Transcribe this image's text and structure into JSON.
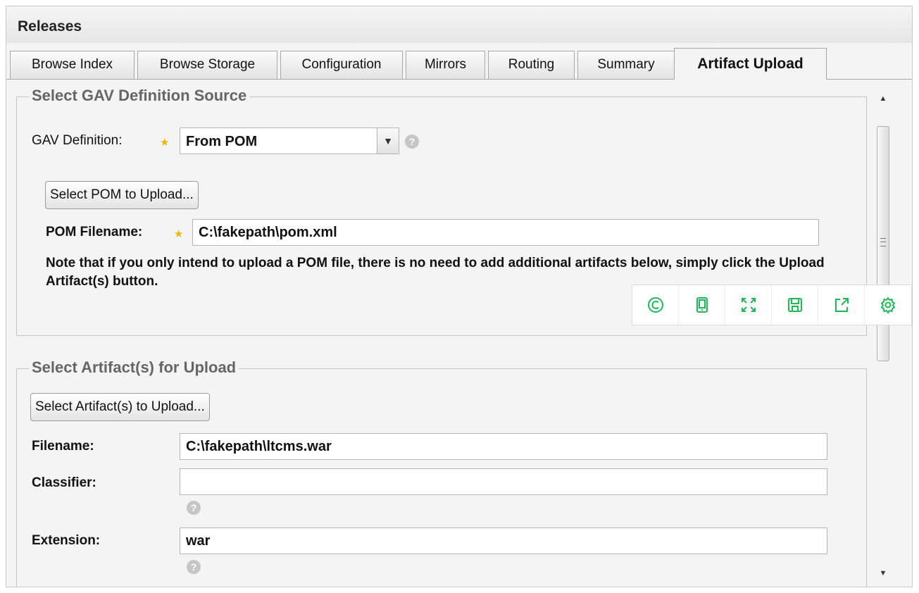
{
  "window": {
    "title": "Releases"
  },
  "tabs": [
    {
      "label": "Browse Index"
    },
    {
      "label": "Browse Storage"
    },
    {
      "label": "Configuration"
    },
    {
      "label": "Mirrors"
    },
    {
      "label": "Routing"
    },
    {
      "label": "Summary"
    },
    {
      "label": "Artifact Upload",
      "active": true
    }
  ],
  "gav_section": {
    "legend": "Select GAV Definition Source",
    "gav_label": "GAV Definition:",
    "gav_value": "From POM",
    "select_pom_button": "Select POM to Upload...",
    "pom_filename_label": "POM Filename:",
    "pom_filename_value": "C:\\fakepath\\pom.xml",
    "note": "Note that if you only intend to upload a POM file, there is no need to add additional artifacts below, simply click the Upload Artifact(s) button."
  },
  "artifact_section": {
    "legend": "Select Artifact(s) for Upload",
    "select_artifacts_button": "Select Artifact(s) to Upload...",
    "filename_label": "Filename:",
    "filename_value": "C:\\fakepath\\ltcms.war",
    "classifier_label": "Classifier:",
    "classifier_value": "",
    "extension_label": "Extension:",
    "extension_value": "war"
  },
  "help_icon_text": "?",
  "required_star": "★",
  "floating_toolbar": {
    "accent_color": "#1db954",
    "icons": [
      "copyright-icon",
      "tablet-icon",
      "fullscreen-icon",
      "save-icon",
      "share-icon",
      "settings-icon"
    ]
  }
}
